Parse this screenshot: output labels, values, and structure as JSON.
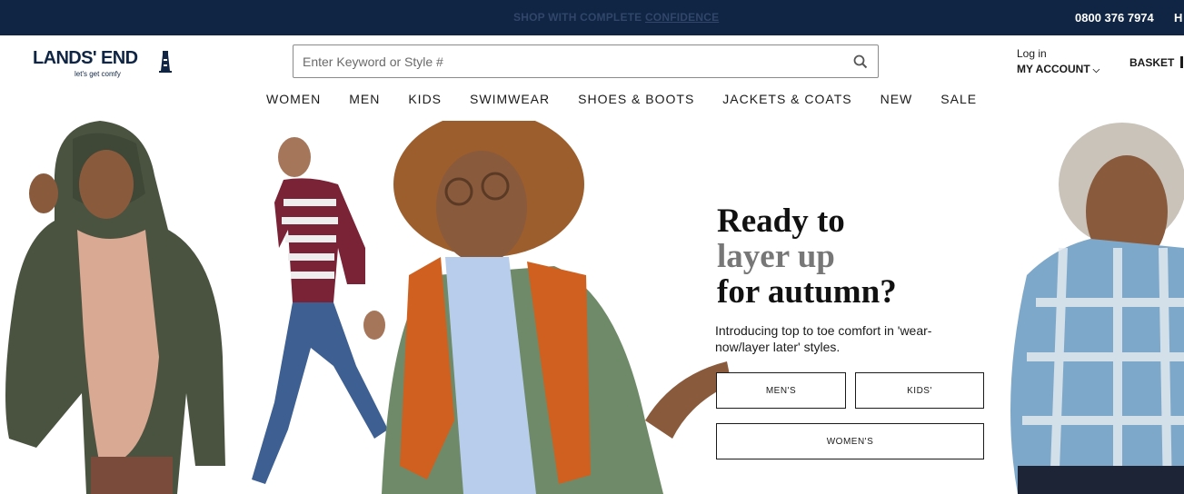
{
  "topbar": {
    "promo_text": "SHOP WITH COMPLETE",
    "promo_link": "CONFIDENCE",
    "phone": "0800 376 7974",
    "help_partial": "H"
  },
  "header": {
    "logo_text": "LANDS' END",
    "logo_tagline": "let's get comfy",
    "search": {
      "placeholder": "Enter Keyword or Style #",
      "value": ""
    },
    "login_label": "Log in",
    "account_label": "MY ACCOUNT",
    "basket_label": "BASKET"
  },
  "nav": {
    "items": [
      "WOMEN",
      "MEN",
      "KIDS",
      "SWIMWEAR",
      "SHOES & BOOTS",
      "JACKETS & COATS",
      "NEW",
      "SALE"
    ]
  },
  "hero": {
    "headline_line1": "Ready to",
    "headline_line2": "layer up",
    "headline_line3": "for autumn?",
    "subtext": "Introducing top to toe comfort in 'wear-now/layer later' styles.",
    "buttons": {
      "mens": "MEN'S",
      "kids": "KIDS'",
      "womens": "WOMEN'S"
    }
  },
  "colors": {
    "topbar_bg": "#0f2543",
    "brand_navy": "#0f2543",
    "headline_gray": "#777777"
  },
  "icons": {
    "search": "search-icon",
    "chevron": "chevron-down-icon",
    "logo": "lighthouse-icon"
  }
}
